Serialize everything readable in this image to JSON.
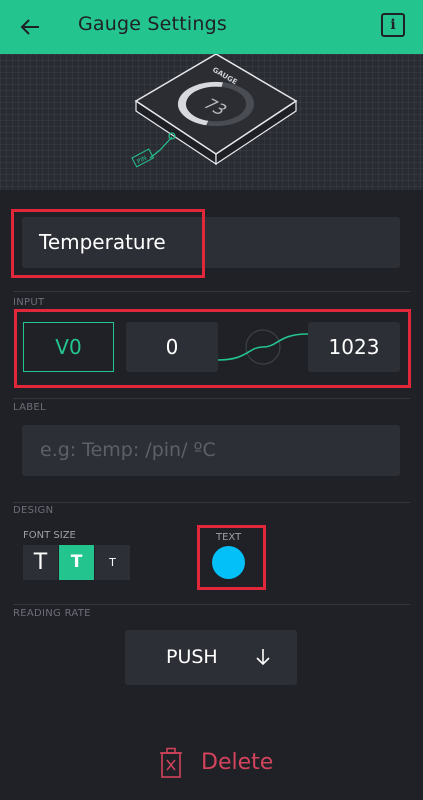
{
  "header": {
    "title": "Gauge Settings",
    "info_label": "i"
  },
  "preview": {
    "widget_label": "GAUGE",
    "value": "73",
    "pin_label": "PIN",
    "fill_fraction": 0.73
  },
  "name_field": {
    "value": "Temperature"
  },
  "input": {
    "section_label": "INPUT",
    "pin": "V0",
    "min": "0",
    "max": "1023"
  },
  "label": {
    "section_label": "LABEL",
    "placeholder": "e.g: Temp: /pin/ ºC"
  },
  "design": {
    "section_label": "DESIGN",
    "font_size_label": "FONT SIZE",
    "font_sizes": [
      "T",
      "T",
      "T"
    ],
    "selected_font_size": 1,
    "text_label": "TEXT",
    "text_color": "#04c0f8"
  },
  "reading_rate": {
    "section_label": "READING RATE",
    "value": "PUSH"
  },
  "delete": {
    "label": "Delete"
  },
  "colors": {
    "accent": "#23c48e",
    "background": "#202127",
    "field": "#2d2f36",
    "danger": "#d3435c",
    "highlight": "#e0283a"
  }
}
